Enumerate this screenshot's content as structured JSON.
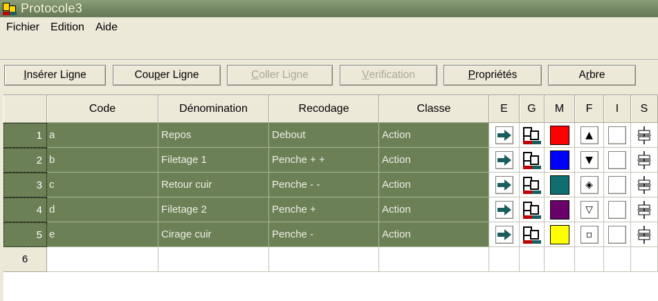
{
  "window": {
    "title": "Protocole3"
  },
  "menu": [
    "Fichier",
    "Edition",
    "Aide"
  ],
  "toolbar": {
    "insert": {
      "pre": "",
      "u": "I",
      "post": "nsérer Ligne"
    },
    "cut": {
      "pre": "Cou",
      "u": "p",
      "post": "er Ligne"
    },
    "paste": {
      "pre": "",
      "u": "C",
      "post": "oller Ligne"
    },
    "verify": {
      "pre": "",
      "u": "V",
      "post": "erification"
    },
    "props": {
      "pre": "",
      "u": "P",
      "post": "ropriétés"
    },
    "tree": {
      "pre": "A",
      "u": "r",
      "post": "bre"
    }
  },
  "columns": [
    "Code",
    "Dénomination",
    "Recodage",
    "Classe",
    "E",
    "G",
    "M",
    "F",
    "I",
    "S"
  ],
  "rows": [
    {
      "num": "1",
      "code": "a",
      "denomination": "Repos",
      "recodage": "Debout",
      "classe": "Action",
      "color": "#ff0000",
      "f_icon": "triangle-up-icon",
      "f_glyph": "▲"
    },
    {
      "num": "2",
      "code": "b",
      "denomination": "Filetage 1",
      "recodage": "Penche + +",
      "classe": "Action",
      "color": "#0000ff",
      "f_icon": "triangle-down-icon",
      "f_glyph": "▼"
    },
    {
      "num": "3",
      "code": "c",
      "denomination": "Retour cuir",
      "recodage": "Penche - -",
      "classe": "Action",
      "color": "#0f6f6f",
      "f_icon": "diamond-dot-icon",
      "f_glyph": "◈"
    },
    {
      "num": "4",
      "code": "d",
      "denomination": "Filetage 2",
      "recodage": "Penche +",
      "classe": "Action",
      "color": "#6a006a",
      "f_icon": "triangle-down-outline-icon",
      "f_glyph": "▽"
    },
    {
      "num": "5",
      "code": "e",
      "denomination": "Cirage cuir",
      "recodage": "Penche -",
      "classe": "Action",
      "color": "#ffff00",
      "f_icon": "small-square-icon",
      "f_glyph": "▫"
    }
  ],
  "empty_row_num": "6",
  "colors": {
    "row_selected": "#6b8055",
    "arrow": "#1b5d5d"
  }
}
